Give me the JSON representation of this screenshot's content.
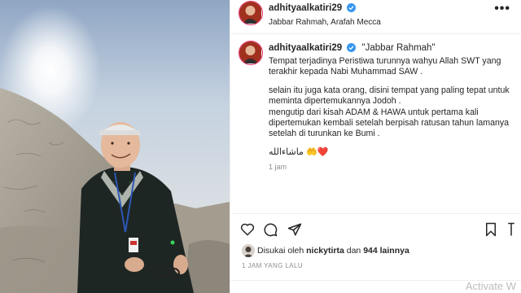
{
  "post": {
    "username": "adhityaalkatiri29",
    "location": "Jabbar Rahmah, Arafah Mecca",
    "more_label": "•••"
  },
  "caption": {
    "username": "adhityaalkatiri29",
    "title": "\"Jabbar Rahmah\"",
    "paragraph1": "Tempat terjadinya Peristiwa turunnya wahyu Allah SWT yang terakhir kepada Nabi Muhammad SAW .",
    "paragraph2": "selain itu juga kata orang, disini tempat yang paling tepat untuk meminta dipertemukannya Jodoh .",
    "paragraph3": "mengutip dari kisah ADAM & HAWA untuk pertama kali dipertemukan kembali setelah berpisah ratusan tahun lamanya setelah di turunkan ke Bumi .",
    "emoji_line": "ماشاءالله 🤲❤️",
    "time": "1 jam"
  },
  "likes": {
    "prefix": "Disukai oleh",
    "user": "nickytirta",
    "connector": "dan",
    "others": "944 lainnya"
  },
  "post_time": "1 JAM YANG LALU",
  "watermark": "Activate W",
  "colors": {
    "text": "#262626",
    "secondary": "#8e8e8e",
    "verified": "#3897f0",
    "border": "#efefef"
  },
  "icons": {
    "like": "heart-outline-icon",
    "comment": "speech-bubble-icon",
    "share": "paper-plane-icon",
    "save": "bookmark-icon",
    "verified": "verified-badge-icon"
  }
}
